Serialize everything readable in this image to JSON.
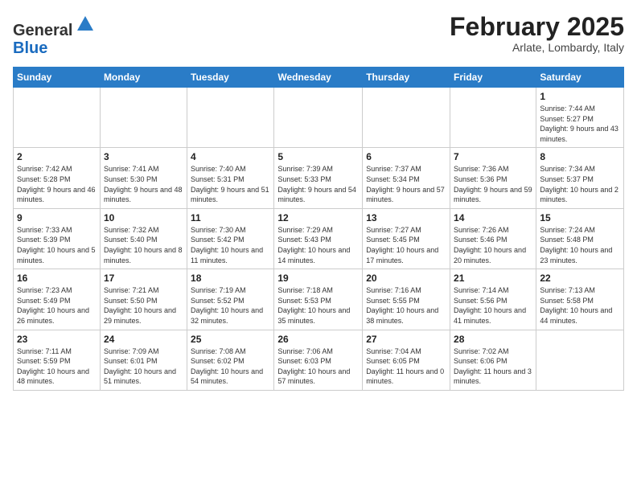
{
  "header": {
    "logo_line1": "General",
    "logo_line2": "Blue",
    "month": "February 2025",
    "location": "Arlate, Lombardy, Italy"
  },
  "weekdays": [
    "Sunday",
    "Monday",
    "Tuesday",
    "Wednesday",
    "Thursday",
    "Friday",
    "Saturday"
  ],
  "weeks": [
    [
      {
        "day": "",
        "info": ""
      },
      {
        "day": "",
        "info": ""
      },
      {
        "day": "",
        "info": ""
      },
      {
        "day": "",
        "info": ""
      },
      {
        "day": "",
        "info": ""
      },
      {
        "day": "",
        "info": ""
      },
      {
        "day": "1",
        "info": "Sunrise: 7:44 AM\nSunset: 5:27 PM\nDaylight: 9 hours and 43 minutes."
      }
    ],
    [
      {
        "day": "2",
        "info": "Sunrise: 7:42 AM\nSunset: 5:28 PM\nDaylight: 9 hours and 46 minutes."
      },
      {
        "day": "3",
        "info": "Sunrise: 7:41 AM\nSunset: 5:30 PM\nDaylight: 9 hours and 48 minutes."
      },
      {
        "day": "4",
        "info": "Sunrise: 7:40 AM\nSunset: 5:31 PM\nDaylight: 9 hours and 51 minutes."
      },
      {
        "day": "5",
        "info": "Sunrise: 7:39 AM\nSunset: 5:33 PM\nDaylight: 9 hours and 54 minutes."
      },
      {
        "day": "6",
        "info": "Sunrise: 7:37 AM\nSunset: 5:34 PM\nDaylight: 9 hours and 57 minutes."
      },
      {
        "day": "7",
        "info": "Sunrise: 7:36 AM\nSunset: 5:36 PM\nDaylight: 9 hours and 59 minutes."
      },
      {
        "day": "8",
        "info": "Sunrise: 7:34 AM\nSunset: 5:37 PM\nDaylight: 10 hours and 2 minutes."
      }
    ],
    [
      {
        "day": "9",
        "info": "Sunrise: 7:33 AM\nSunset: 5:39 PM\nDaylight: 10 hours and 5 minutes."
      },
      {
        "day": "10",
        "info": "Sunrise: 7:32 AM\nSunset: 5:40 PM\nDaylight: 10 hours and 8 minutes."
      },
      {
        "day": "11",
        "info": "Sunrise: 7:30 AM\nSunset: 5:42 PM\nDaylight: 10 hours and 11 minutes."
      },
      {
        "day": "12",
        "info": "Sunrise: 7:29 AM\nSunset: 5:43 PM\nDaylight: 10 hours and 14 minutes."
      },
      {
        "day": "13",
        "info": "Sunrise: 7:27 AM\nSunset: 5:45 PM\nDaylight: 10 hours and 17 minutes."
      },
      {
        "day": "14",
        "info": "Sunrise: 7:26 AM\nSunset: 5:46 PM\nDaylight: 10 hours and 20 minutes."
      },
      {
        "day": "15",
        "info": "Sunrise: 7:24 AM\nSunset: 5:48 PM\nDaylight: 10 hours and 23 minutes."
      }
    ],
    [
      {
        "day": "16",
        "info": "Sunrise: 7:23 AM\nSunset: 5:49 PM\nDaylight: 10 hours and 26 minutes."
      },
      {
        "day": "17",
        "info": "Sunrise: 7:21 AM\nSunset: 5:50 PM\nDaylight: 10 hours and 29 minutes."
      },
      {
        "day": "18",
        "info": "Sunrise: 7:19 AM\nSunset: 5:52 PM\nDaylight: 10 hours and 32 minutes."
      },
      {
        "day": "19",
        "info": "Sunrise: 7:18 AM\nSunset: 5:53 PM\nDaylight: 10 hours and 35 minutes."
      },
      {
        "day": "20",
        "info": "Sunrise: 7:16 AM\nSunset: 5:55 PM\nDaylight: 10 hours and 38 minutes."
      },
      {
        "day": "21",
        "info": "Sunrise: 7:14 AM\nSunset: 5:56 PM\nDaylight: 10 hours and 41 minutes."
      },
      {
        "day": "22",
        "info": "Sunrise: 7:13 AM\nSunset: 5:58 PM\nDaylight: 10 hours and 44 minutes."
      }
    ],
    [
      {
        "day": "23",
        "info": "Sunrise: 7:11 AM\nSunset: 5:59 PM\nDaylight: 10 hours and 48 minutes."
      },
      {
        "day": "24",
        "info": "Sunrise: 7:09 AM\nSunset: 6:01 PM\nDaylight: 10 hours and 51 minutes."
      },
      {
        "day": "25",
        "info": "Sunrise: 7:08 AM\nSunset: 6:02 PM\nDaylight: 10 hours and 54 minutes."
      },
      {
        "day": "26",
        "info": "Sunrise: 7:06 AM\nSunset: 6:03 PM\nDaylight: 10 hours and 57 minutes."
      },
      {
        "day": "27",
        "info": "Sunrise: 7:04 AM\nSunset: 6:05 PM\nDaylight: 11 hours and 0 minutes."
      },
      {
        "day": "28",
        "info": "Sunrise: 7:02 AM\nSunset: 6:06 PM\nDaylight: 11 hours and 3 minutes."
      },
      {
        "day": "",
        "info": ""
      }
    ]
  ]
}
